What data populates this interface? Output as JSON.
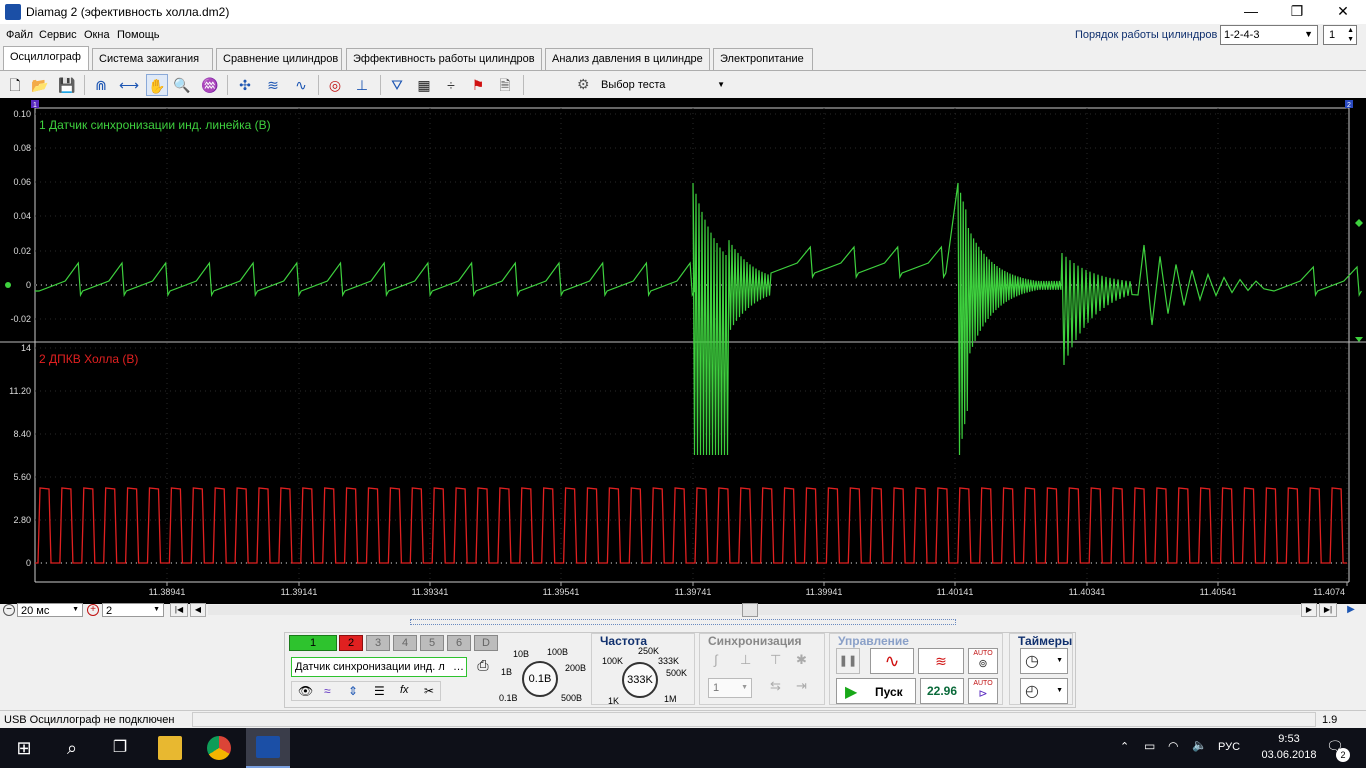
{
  "window": {
    "title": "Diamag 2 (эфективность холла.dm2)",
    "minimize": "—",
    "maximize": "❐",
    "close": "✕"
  },
  "menu": {
    "items": [
      "Файл",
      "Сервис",
      "Окна",
      "Помощь"
    ],
    "cyl_order_label": "Порядок работы цилиндров",
    "cyl_order_value": "1-2-4-3",
    "cyl_num_value": "1"
  },
  "tabs": [
    "Осциллограф",
    "Система зажигания",
    "Сравнение цилиндров",
    "Эффективность работы цилиндров",
    "Анализ давления в цилиндре",
    "Электропитание"
  ],
  "toolbar": {
    "test_select": "Выбор теста",
    "icons": [
      "new-file-icon",
      "open-folder-icon",
      "save-icon",
      "cursor-markers-icon",
      "measure-icon",
      "hand-tool-icon",
      "zoom-icon",
      "scale-icon",
      "filter-icon",
      "average-icon",
      "spectrum-icon",
      "auto-scale-icon",
      "auto-zero-icon",
      "filter-funnel-icon",
      "table-icon",
      "separator-icon",
      "flag-icon",
      "document-icon"
    ]
  },
  "scope": {
    "channel1": {
      "label": "1 Датчик синхронизации инд. линейка (В)",
      "color": "#3ed13e",
      "yticks": [
        "0.10",
        "0.08",
        "0.06",
        "0.04",
        "0.02",
        "0",
        "-0.02"
      ]
    },
    "channel2": {
      "label": "2 ДПКВ Холла (В)",
      "color": "#e02020",
      "yticks": [
        "14",
        "11.20",
        "8.40",
        "5.60",
        "2.80",
        "0"
      ]
    },
    "xticks": [
      "11.38941",
      "11.39141",
      "11.39341",
      "11.39541",
      "11.39741",
      "11.39941",
      "11.40141",
      "11.40341",
      "11.40541",
      "11.4074"
    ],
    "marker_left": "1",
    "marker_right": "2"
  },
  "timebase": {
    "value": "20 мс",
    "channels_value": "2"
  },
  "channel_buttons": [
    "1",
    "2",
    "3",
    "4",
    "5",
    "6",
    "D"
  ],
  "channel_sensor": "Датчик синхронизации инд. ли",
  "volt_knob": {
    "value": "0.1В",
    "labels": [
      "10В",
      "100В",
      "200В",
      "500В",
      "0.1В",
      "1В"
    ]
  },
  "frequency": {
    "title": "Частота",
    "value": "333K",
    "labels": [
      "250K",
      "100K",
      "333K",
      "500K",
      "1K",
      "1M"
    ]
  },
  "sync": {
    "title": "Синхронизация",
    "channel": "1"
  },
  "control": {
    "title": "Управление",
    "start": "Пуск",
    "value": "22.96",
    "auto": "AUTO"
  },
  "timers": {
    "title": "Таймеры"
  },
  "status": {
    "text": "USB Осциллограф не подключен",
    "version": "1.9"
  },
  "taskbar": {
    "lang": "РУС",
    "time": "9:53",
    "date": "03.06.2018",
    "notif": "2"
  }
}
